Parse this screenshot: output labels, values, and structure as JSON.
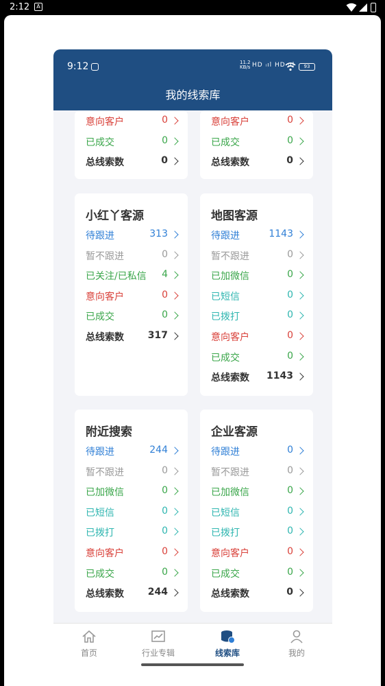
{
  "system_bar": {
    "time": "2:12",
    "app_icon_letter": "A"
  },
  "app_status": {
    "time": "9:12",
    "net_speed_top": "11.2",
    "net_speed_bottom": "KB/s",
    "network": "HD ᵢıl HD ᵢıl",
    "battery": "93"
  },
  "header": {
    "title": "我的线索库"
  },
  "top_cards": [
    {
      "rows": [
        {
          "label": "意向客户",
          "value": "0",
          "color": "red"
        },
        {
          "label": "已成交",
          "value": "0",
          "color": "green"
        },
        {
          "label": "总线索数",
          "value": "0",
          "color": "dark"
        }
      ]
    },
    {
      "rows": [
        {
          "label": "意向客户",
          "value": "0",
          "color": "red"
        },
        {
          "label": "已成交",
          "value": "0",
          "color": "green"
        },
        {
          "label": "总线索数",
          "value": "0",
          "color": "dark"
        }
      ]
    }
  ],
  "cards": [
    {
      "title": "小红丫客源",
      "rows": [
        {
          "label": "待跟进",
          "value": "313"
        },
        {
          "label": "暂不跟进",
          "value": "0"
        },
        {
          "label": "已关注/已私信",
          "value": "4"
        },
        {
          "label": "意向客户",
          "value": "0"
        },
        {
          "label": "已成交",
          "value": "0"
        },
        {
          "label": "总线索数",
          "value": "317"
        }
      ]
    },
    {
      "title": "地图客源",
      "rows": [
        {
          "label": "待跟进",
          "value": "1143"
        },
        {
          "label": "暂不跟进",
          "value": "0"
        },
        {
          "label": "已加微信",
          "value": "0"
        },
        {
          "label": "已短信",
          "value": "0"
        },
        {
          "label": "已拨打",
          "value": "0"
        },
        {
          "label": "意向客户",
          "value": "0"
        },
        {
          "label": "已成交",
          "value": "0"
        },
        {
          "label": "总线索数",
          "value": "1143"
        }
      ]
    },
    {
      "title": "附近搜索",
      "rows": [
        {
          "label": "待跟进",
          "value": "244"
        },
        {
          "label": "暂不跟进",
          "value": "0"
        },
        {
          "label": "已加微信",
          "value": "0"
        },
        {
          "label": "已短信",
          "value": "0"
        },
        {
          "label": "已拨打",
          "value": "0"
        },
        {
          "label": "意向客户",
          "value": "0"
        },
        {
          "label": "已成交",
          "value": "0"
        },
        {
          "label": "总线索数",
          "value": "244"
        }
      ]
    },
    {
      "title": "企业客源",
      "rows": [
        {
          "label": "待跟进",
          "value": "0"
        },
        {
          "label": "暂不跟进",
          "value": "0"
        },
        {
          "label": "已加微信",
          "value": "0"
        },
        {
          "label": "已短信",
          "value": "0"
        },
        {
          "label": "已拨打",
          "value": "0"
        },
        {
          "label": "意向客户",
          "value": "0"
        },
        {
          "label": "已成交",
          "value": "0"
        },
        {
          "label": "总线索数",
          "value": "0"
        }
      ]
    }
  ],
  "tabs": [
    {
      "label": "首页",
      "icon": "home-icon",
      "active": false
    },
    {
      "label": "行业专辑",
      "icon": "chart-icon",
      "active": false
    },
    {
      "label": "线索库",
      "icon": "database-icon",
      "active": true
    },
    {
      "label": "我的",
      "icon": "user-icon",
      "active": false
    }
  ],
  "colors": {
    "header": "#1f4e82",
    "blue": "#2f7fd6",
    "gray": "#9a9a9a",
    "green": "#3aa64a",
    "red": "#d9413a",
    "teal": "#2fb6b0"
  }
}
